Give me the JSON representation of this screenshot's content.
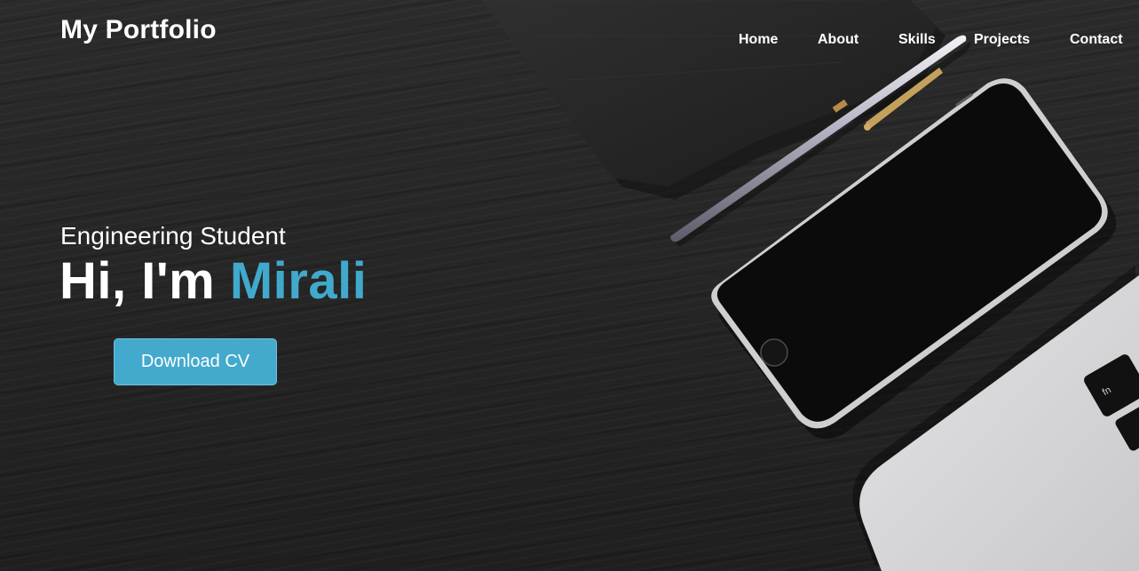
{
  "brand": {
    "title": "My Portfolio"
  },
  "nav": {
    "items": [
      {
        "label": "Home"
      },
      {
        "label": "About"
      },
      {
        "label": "Skills"
      },
      {
        "label": "Projects"
      },
      {
        "label": "Contact"
      }
    ]
  },
  "hero": {
    "subtitle": "Engineering Student",
    "greeting": "Hi, I'm ",
    "name": "Mirali",
    "cta_label": "Download CV"
  },
  "background": {
    "objects": [
      "notebook",
      "pen",
      "smartphone",
      "laptop"
    ],
    "laptop_key_labels": [
      "fn"
    ]
  },
  "colors": {
    "accent": "#41a9cc",
    "button": "#43aacd",
    "background": "#262626",
    "text": "#ffffff"
  }
}
